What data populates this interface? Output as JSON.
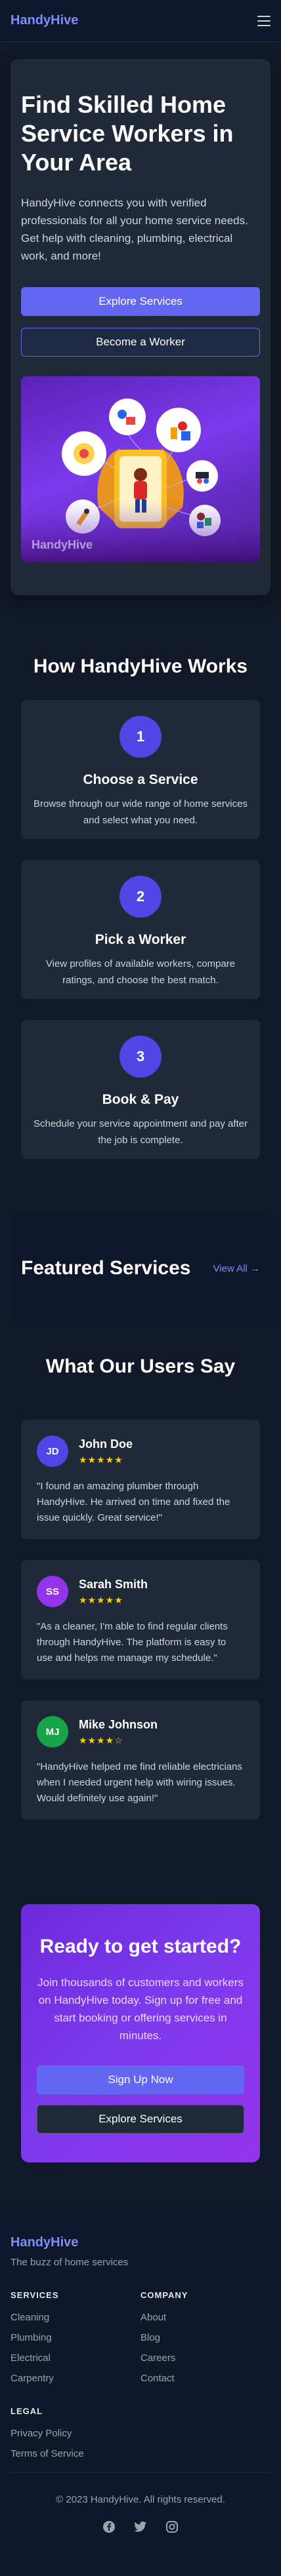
{
  "nav": {
    "brand": "HandyHive",
    "menu_icon": "hamburger-menu-icon"
  },
  "hero": {
    "title": "Find Skilled Home Service Workers in Your Area",
    "description": "HandyHive connects you with verified professionals for all your home service needs. Get help with cleaning, plumbing, electrical work, and more!",
    "primary_button": "Explore Services",
    "secondary_button": "Become a Worker",
    "image_watermark": "HandyHive"
  },
  "how": {
    "title": "How HandyHive Works",
    "steps": [
      {
        "number": "1",
        "title": "Choose a Service",
        "description": "Browse through our wide range of home services and select what you need."
      },
      {
        "number": "2",
        "title": "Pick a Worker",
        "description": "View profiles of available workers, compare ratings, and choose the best match."
      },
      {
        "number": "3",
        "title": "Book & Pay",
        "description": "Schedule your service appointment and pay after the job is complete."
      }
    ]
  },
  "featured": {
    "title": "Featured Services",
    "view_all": "View All →"
  },
  "testimonials": {
    "title": "What Our Users Say",
    "items": [
      {
        "initials": "JD",
        "name": "John Doe",
        "stars": "★★★★★",
        "avatar_color": "#4f46e5",
        "quote": "\"I found an amazing plumber through HandyHive. He arrived on time and fixed the issue quickly. Great service!\""
      },
      {
        "initials": "SS",
        "name": "Sarah Smith",
        "stars": "★★★★★",
        "avatar_color": "#9333ea",
        "quote": "\"As a cleaner, I'm able to find regular clients through HandyHive. The platform is easy to use and helps me manage my schedule.\""
      },
      {
        "initials": "MJ",
        "name": "Mike Johnson",
        "stars": "★★★★☆",
        "avatar_color": "#16a34a",
        "quote": "\"HandyHive helped me find reliable electricians when I needed urgent help with wiring issues. Would definitely use again!\""
      }
    ]
  },
  "cta": {
    "title": "Ready to get started?",
    "description": "Join thousands of customers and workers on HandyHive today. Sign up for free and start booking or offering services in minutes.",
    "primary_button": "Sign Up Now",
    "secondary_button": "Explore Services"
  },
  "footer": {
    "brand": "HandyHive",
    "tagline": "The buzz of home services",
    "services_heading": "SERVICES",
    "services": [
      "Cleaning",
      "Plumbing",
      "Electrical",
      "Carpentry"
    ],
    "company_heading": "COMPANY",
    "company": [
      "About",
      "Blog",
      "Careers",
      "Contact"
    ],
    "legal_heading": "LEGAL",
    "legal": [
      "Privacy Policy",
      "Terms of Service"
    ],
    "copyright": "© 2023 HandyHive. All rights reserved.",
    "social_icons": [
      "facebook-icon",
      "twitter-icon",
      "instagram-icon"
    ]
  },
  "colors": {
    "accent": "#6366f1",
    "brand_text": "#818cf8",
    "step_circle": "#4f46e5",
    "star": "#facc15",
    "background": "#111827",
    "card": "#1f2937"
  }
}
